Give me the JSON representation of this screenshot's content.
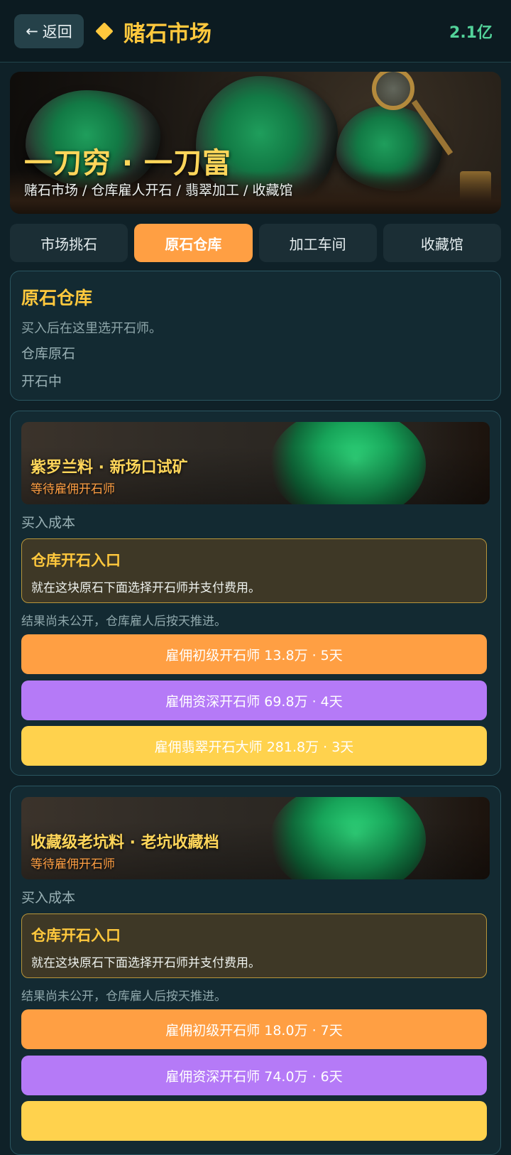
{
  "header": {
    "back_label": "返回",
    "title": "赌石市场",
    "balance": "2.1亿"
  },
  "banner": {
    "title": "一刀穷 · 一刀富",
    "subtitle": "赌石市场 / 仓库雇人开石 / 翡翠加工 / 收藏馆"
  },
  "tabs": [
    {
      "label": "市场挑石",
      "active": false
    },
    {
      "label": "原石仓库",
      "active": true
    },
    {
      "label": "加工车间",
      "active": false
    },
    {
      "label": "收藏馆",
      "active": false
    }
  ],
  "warehouse": {
    "heading": "原石仓库",
    "description": "买入后在这里选开石师。",
    "line1": "仓库原石",
    "line2": "开石中"
  },
  "stones": [
    {
      "name": "紫罗兰料 · 新场口试矿",
      "status": "等待雇佣开石师",
      "cost_label": "买入成本",
      "entry_title": "仓库开石入口",
      "entry_desc": "就在这块原石下面选择开石师并支付费用。",
      "note": "结果尚未公开，仓库雇人后按天推进。",
      "hires": [
        "雇佣初级开石师 13.8万 · 5天",
        "雇佣资深开石师 69.8万 · 4天",
        "雇佣翡翠开石大师 281.8万 · 3天"
      ]
    },
    {
      "name": "收藏级老坑料 · 老坑收藏档",
      "status": "等待雇佣开石师",
      "cost_label": "买入成本",
      "entry_title": "仓库开石入口",
      "entry_desc": "就在这块原石下面选择开石师并支付费用。",
      "note": "结果尚未公开，仓库雇人后按天推进。",
      "hires": [
        "雇佣初级开石师 18.0万 · 7天",
        "雇佣资深开石师 74.0万 · 6天",
        ""
      ]
    }
  ],
  "colors": {
    "accent_gold": "#ffc83d",
    "tab_active": "#ff9f43",
    "hire_junior": "#ff9f43",
    "hire_senior": "#b57af7",
    "hire_master": "#ffd24d",
    "balance": "#53d39a"
  }
}
